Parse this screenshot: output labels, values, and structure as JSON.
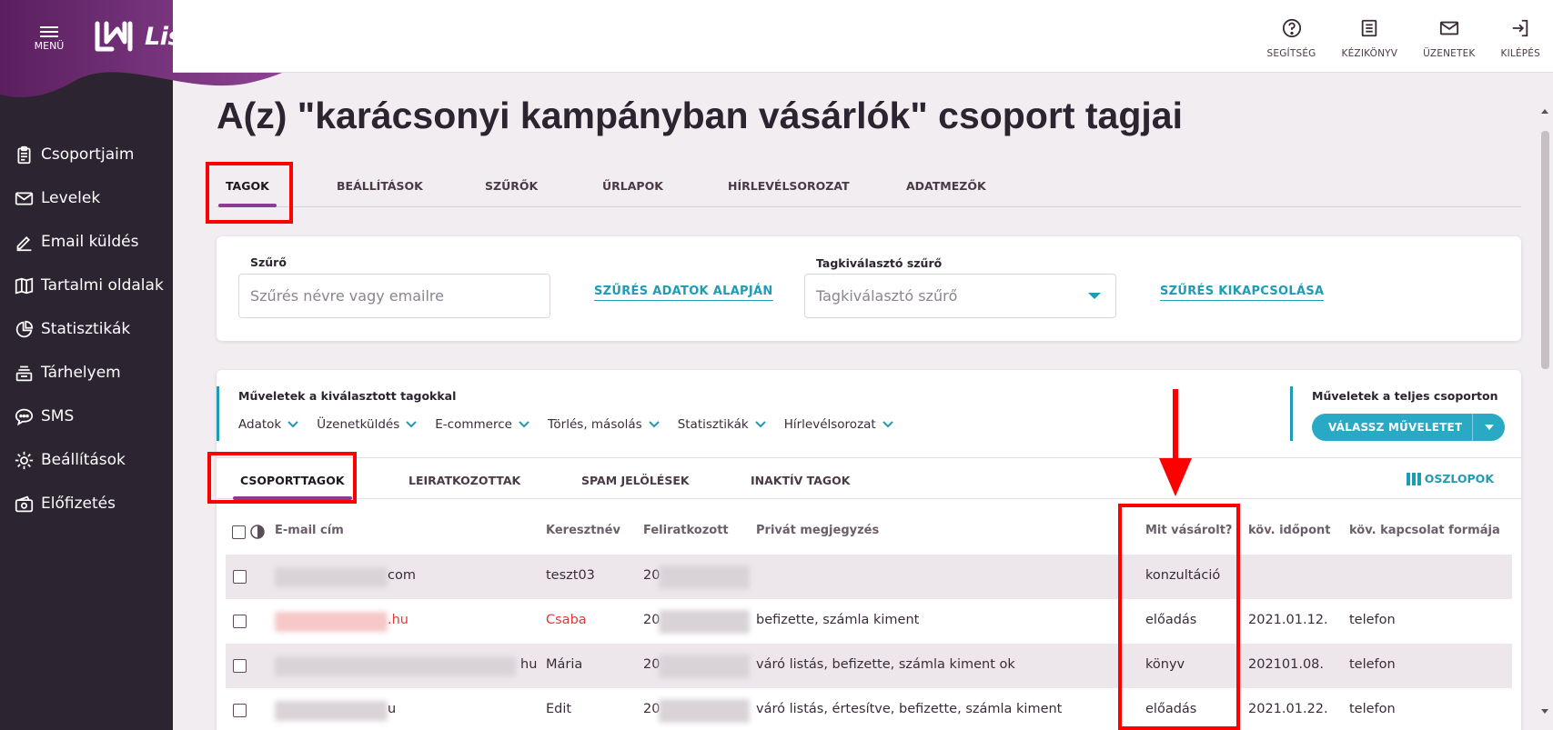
{
  "app": {
    "brand": "ListaMester",
    "menu_label": "MENÜ",
    "brand_color": "#8a3d8f",
    "accent_color": "#1e9bb5"
  },
  "topbar": {
    "help": "SEGÍTSÉG",
    "manual": "KÉZIKÖNYV",
    "messages": "ÜZENETEK",
    "logout": "KILÉPÉS"
  },
  "sidebar": {
    "items": [
      {
        "label": "Csoportjaim",
        "icon": "clipboard-icon"
      },
      {
        "label": "Levelek",
        "icon": "envelope-icon"
      },
      {
        "label": "Email küldés",
        "icon": "pen-icon"
      },
      {
        "label": "Tartalmi oldalak",
        "icon": "book-icon"
      },
      {
        "label": "Statisztikák",
        "icon": "pie-chart-icon"
      },
      {
        "label": "Tárhelyem",
        "icon": "storage-icon"
      },
      {
        "label": "SMS",
        "icon": "chat-icon"
      },
      {
        "label": "Beállítások",
        "icon": "gear-icon"
      },
      {
        "label": "Előfizetés",
        "icon": "wallet-icon"
      }
    ]
  },
  "page": {
    "title": "A(z) \"karácsonyi kampányban vásárlók\" csoport tagjai"
  },
  "tabs": [
    "TAGOK",
    "BEÁLLÍTÁSOK",
    "SZŰRŐK",
    "ŰRLAPOK",
    "HÍRLEVÉLSOROZAT",
    "ADATMEZŐK"
  ],
  "filter": {
    "label": "Szűrő",
    "placeholder": "Szűrés névre vagy emailre",
    "data_filter_link": "SZŰRÉS ADATOK ALAPJÁN",
    "member_select_label": "Tagkiválasztó szűrő",
    "member_select_placeholder": "Tagkiválasztó szűrő",
    "disable_link": "SZŰRÉS KIKAPCSOLÁSA"
  },
  "operations": {
    "selected_title": "Műveletek a kiválasztott tagokkal",
    "menu": [
      "Adatok",
      "Üzenetküldés",
      "E-commerce",
      "Törlés, másolás",
      "Statisztikák",
      "Hírlevélsorozat"
    ],
    "group_title": "Műveletek a teljes csoporton",
    "group_button": "VÁLASSZ MŰVELETET"
  },
  "subtabs": [
    "CSOPORTTAGOK",
    "LEIRATKOZOTTAK",
    "SPAM JELÖLÉSEK",
    "INAKTÍV TAGOK"
  ],
  "columns_button": "OSZLOPOK",
  "table": {
    "headers": [
      "E-mail cím",
      "Keresztnév",
      "Feliratkozott",
      "Privát megjegyzés",
      "Mit vásárolt?",
      "köv. időpont",
      "köv. kapcsolat formája"
    ],
    "rows": [
      {
        "email": "com",
        "name": "teszt03",
        "subscribed": "20",
        "note": "",
        "bought": "konzultáció",
        "next_date": "",
        "contact": ""
      },
      {
        "email": ".hu",
        "name": "Csaba",
        "subscribed": "20",
        "note": "befizette, számla kiment",
        "bought": "előadás",
        "next_date": "2021.01.12.",
        "contact": "telefon"
      },
      {
        "email": "hu",
        "name": "Mária",
        "subscribed": "20",
        "note": "váró listás, befizette, számla kiment ok",
        "bought": "könyv",
        "next_date": "202101.08.",
        "contact": "telefon"
      },
      {
        "email": "u",
        "name": "Edit",
        "subscribed": "20",
        "note": "váró listás, értesítve, befizette, számla kiment",
        "bought": "előadás",
        "next_date": "2021.01.22.",
        "contact": "telefon"
      }
    ]
  }
}
